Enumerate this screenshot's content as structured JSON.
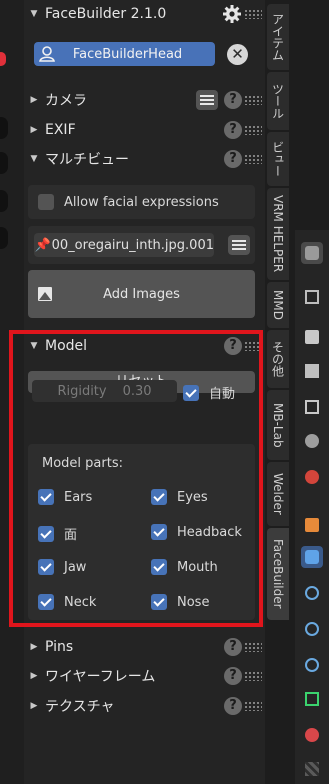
{
  "facebuilder": {
    "title": "FaceBuilder 2.1.0",
    "head_name": "FaceBuilderHead"
  },
  "panels": {
    "camera": "カメラ",
    "exif": "EXIF",
    "multiview": "マルチビュー",
    "model": "Model",
    "pins": "Pins",
    "wireframe": "ワイヤーフレーム",
    "texture": "テクスチャ"
  },
  "multiview": {
    "allow_facial_expressions": "Allow facial expressions",
    "file_name": "00_oregairu_inth.jpg.001",
    "add_images": "Add Images"
  },
  "model": {
    "reset": "リセット",
    "rigidity_label": "Rigidity",
    "rigidity_value": "0.30",
    "auto_label": "自動",
    "auto_checked": true,
    "parts_title": "Model parts:",
    "parts": [
      {
        "label": "Ears",
        "checked": true
      },
      {
        "label": "Eyes",
        "checked": true
      },
      {
        "label": "面",
        "checked": true
      },
      {
        "label": "Headback",
        "checked": true
      },
      {
        "label": "Jaw",
        "checked": true
      },
      {
        "label": "Mouth",
        "checked": true
      },
      {
        "label": "Neck",
        "checked": true
      },
      {
        "label": "Nose",
        "checked": true
      }
    ]
  },
  "tabs": [
    "アイテム",
    "ツール",
    "ビュー",
    "VRM HELPER",
    "MMD",
    "その他",
    "MB-Lab",
    "Welder",
    "FaceBuilder"
  ],
  "active_tab": "FaceBuilder",
  "colors": {
    "accent": "#4872b8",
    "highlight_border": "#e0151c",
    "panel_bg": "#242424"
  },
  "icons": {
    "settings": "gear-icon",
    "help": "question-icon",
    "remove": "close-icon",
    "pin": "pin-icon",
    "image": "image-icon",
    "user": "user-icon"
  }
}
